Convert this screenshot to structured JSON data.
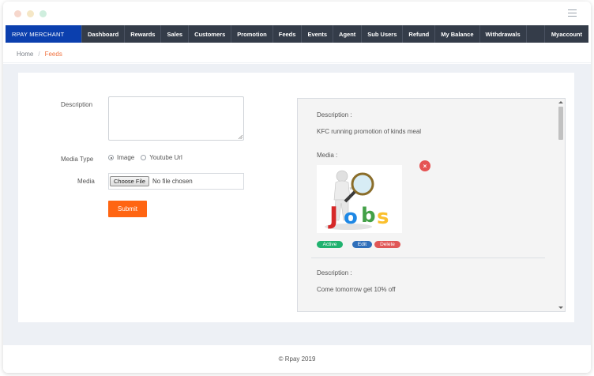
{
  "nav": {
    "brand": "RPAY MERCHANT",
    "items": [
      "Dashboard",
      "Rewards",
      "Sales",
      "Customers",
      "Promotion",
      "Feeds",
      "Events",
      "Agent",
      "Sub Users",
      "Refund",
      "My Balance",
      "Withdrawals"
    ],
    "account": "Myaccount"
  },
  "breadcrumb": {
    "home": "Home",
    "separator": "/",
    "current": "Feeds"
  },
  "form": {
    "description_label": "Description",
    "description_value": "",
    "media_type_label": "Media Type",
    "media_type_options": [
      "Image",
      "Youtube Url"
    ],
    "media_type_selected": "Image",
    "media_label": "Media",
    "choose_file_label": "Choose File",
    "file_status": "No file chosen",
    "submit_label": "Submit"
  },
  "feeds": [
    {
      "description_label": "Description :",
      "description": "KFC running promotion of kinds meal",
      "media_label": "Media :",
      "status": "Active",
      "edit_label": "Edit",
      "delete_label": "Delete"
    },
    {
      "description_label": "Description :",
      "description": "Come tomorrow get 10% off"
    }
  ],
  "colors": {
    "brand": "#0b3fae",
    "navbar": "#343c49",
    "accent": "#ff6512",
    "active": "#20b26f",
    "edit": "#2f6fba",
    "delete": "#e05656"
  },
  "footer": {
    "copyright": "© Rpay 2019"
  }
}
